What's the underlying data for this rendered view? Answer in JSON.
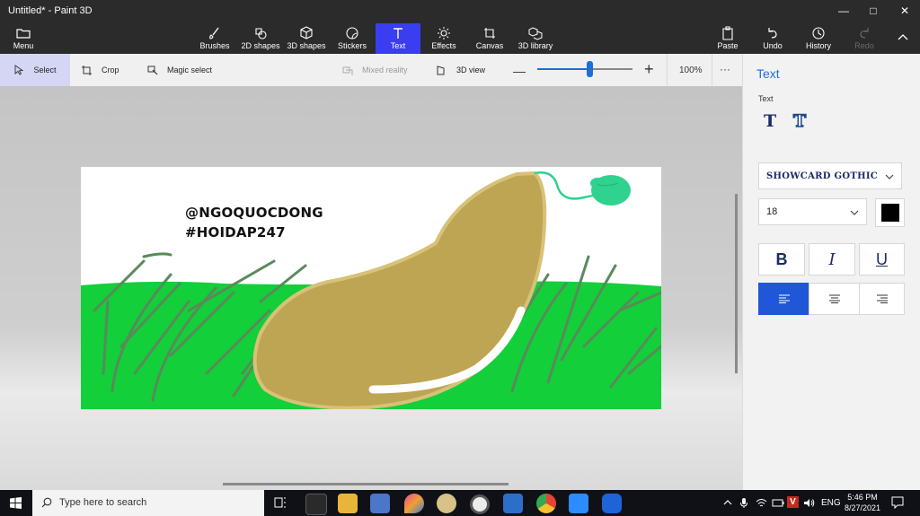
{
  "window": {
    "title": "Untitled* - Paint 3D"
  },
  "ribbon": {
    "menu": "Menu",
    "tools": [
      "Brushes",
      "2D shapes",
      "3D shapes",
      "Stickers",
      "Text",
      "Effects",
      "Canvas",
      "3D library"
    ],
    "active_tool": "Text",
    "right": [
      "Paste",
      "Undo",
      "History",
      "Redo"
    ],
    "accent": "#3a3df0"
  },
  "toolbar": {
    "select": "Select",
    "crop": "Crop",
    "magic_select": "Magic select",
    "mixed_reality": "Mixed reality",
    "view3d": "3D view",
    "zoom": "100%",
    "zoom_level": 0.55,
    "more": "···"
  },
  "canvas": {
    "text_lines": [
      "@NGOQUOCDONG",
      "#HOIDAP247"
    ]
  },
  "panel": {
    "title": "Text",
    "subtitle": "Text",
    "font": "Showcard Gothic",
    "size": "18",
    "color": "#000000",
    "bold": "B",
    "italic": "I",
    "underline": "U",
    "align_active": "left"
  },
  "taskbar": {
    "search_placeholder": "Type here to search",
    "lang": "ENG",
    "time": "5:46 PM",
    "date": "8/27/2021"
  }
}
